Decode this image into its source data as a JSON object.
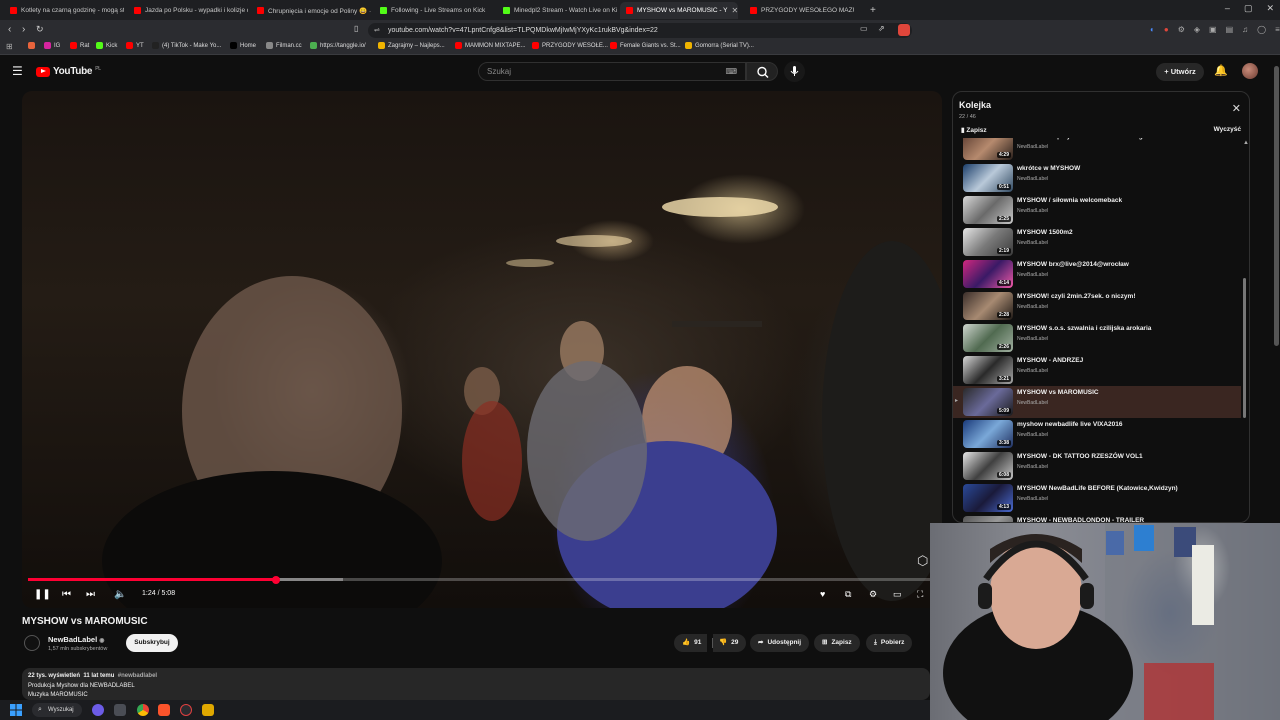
{
  "browser": {
    "tabs": [
      {
        "label": "Kotlety na czarną godzinę - mogą st",
        "color": "#ff0000"
      },
      {
        "label": "Jazda po Polsku - wypadki i kolizje d",
        "color": "#ff0000"
      },
      {
        "label": "Chrupnięcia i emocje od Poliny 😀 ·",
        "color": "#ff0000"
      },
      {
        "label": "Following - Live Streams on Kick",
        "color": "#53fc18"
      },
      {
        "label": "Minedpl2 Stream - Watch Live on Ki",
        "color": "#53fc18"
      },
      {
        "label": "MYSHOW vs MAROMUSIC - Y",
        "color": "#ff0000"
      },
      {
        "label": "PRZYGODY WESOŁEGO MAZURA wr",
        "color": "#ff0000"
      }
    ],
    "new_tab": "+",
    "window_controls": [
      "–",
      "▢",
      "✕"
    ],
    "url": "youtube.com/watch?v=47LpntCnfg8&list=TLPQMDkwMjIwMjYXyKc1rukBVg&index=22",
    "bookmarks": [
      {
        "label": "",
        "color": "#e8643c"
      },
      {
        "label": "IG",
        "color": "#d6249f"
      },
      {
        "label": "Rat",
        "color": "#ff0000"
      },
      {
        "label": "Kick",
        "color": "#53fc18"
      },
      {
        "label": "YT",
        "color": "#ff0000"
      },
      {
        "label": "(4) TikTok - Make Yo...",
        "color": "#222222"
      },
      {
        "label": "Home",
        "color": "#000000"
      },
      {
        "label": "Filman.cc",
        "color": "#888888"
      },
      {
        "label": "https://tanggle.io/",
        "color": "#4caf50"
      },
      {
        "label": "Zagrajmy – Najleps...",
        "color": "#f0b400"
      },
      {
        "label": "MAMMON MIXTAPE...",
        "color": "#ff0000"
      },
      {
        "label": "PRZYGODY WESOŁE...",
        "color": "#ff0000"
      },
      {
        "label": "Female Giants vs. St...",
        "color": "#ff0000"
      },
      {
        "label": "Gomorra (Serial TV)...",
        "color": "#f0b400"
      }
    ]
  },
  "youtube": {
    "logo_text": "YouTube",
    "logo_region": "PL",
    "search_placeholder": "Szukaj",
    "create_label": "Utwórz",
    "accent_color": "#ff0033"
  },
  "player": {
    "current_time": "1:24",
    "duration": "5:08",
    "time_display": "1:24 / 5:08",
    "played_fraction": 0.273,
    "buffered_fraction": 0.347
  },
  "video": {
    "title": "MYSHOW vs MAROMUSIC",
    "channel": "NewBadLabel",
    "verified_mark": "◉",
    "subscribers": "1,57 mln subskrybentów",
    "subscribe_label": "Subskrybuj",
    "likes": "91",
    "dislikes": "29",
    "share_label": "Udostępnij",
    "save_label": "Zapisz",
    "download_label": "Pobierz",
    "views": "22 tys. wyświetleń",
    "age": "11 lat temu",
    "hashtag": "#newbadlabel",
    "desc_line1": "Produkcja Myshow dla NEWBADLABEL",
    "desc_line2": "Muzyka MAROMUSIC"
  },
  "queue": {
    "title": "Kolejka",
    "position": "22 / 46",
    "save_label": "Zapisz",
    "clear_label": "Wyczyść",
    "items": [
      {
        "title": "MYSHOW X! przykazanie video backstage",
        "channel": "NewBadLabel",
        "duration": "4:29",
        "active": false
      },
      {
        "title": "wkrótce w MYSHOW",
        "channel": "NewBadLabel",
        "duration": "0:51",
        "active": false
      },
      {
        "title": "MYSHOW / siłownia welcomeback",
        "channel": "NewBadLabel",
        "duration": "2:25",
        "active": false
      },
      {
        "title": "MYSHOW 1500m2",
        "channel": "NewBadLabel",
        "duration": "2:19",
        "active": false
      },
      {
        "title": "MYSHOW brx@live@2014@wrocław",
        "channel": "NewBadLabel",
        "duration": "4:14",
        "active": false
      },
      {
        "title": "MYSHOW! czyli 2min.27sek. o niczym!",
        "channel": "NewBadLabel",
        "duration": "2:28",
        "active": false
      },
      {
        "title": "MYSHOW s.o.s. szwalnia i czilijska arokaria",
        "channel": "NewBadLabel",
        "duration": "2:26",
        "active": false
      },
      {
        "title": "MYSHOW - ANDRZEJ",
        "channel": "NewBadLabel",
        "duration": "3:21",
        "active": false
      },
      {
        "title": "MYSHOW vs MAROMUSIC",
        "channel": "NewBadLabel",
        "duration": "5:09",
        "active": true
      },
      {
        "title": "myshow newbadlife live VIXA2016",
        "channel": "NewBadLabel",
        "duration": "3:38",
        "active": false
      },
      {
        "title": "MYSHOW - DK TATTOO RZESZÓW VOL1",
        "channel": "NewBadLabel",
        "duration": "6:08",
        "active": false
      },
      {
        "title": "MYSHOW NewBadLife BEFORE (Katowice,Kwidzyn)",
        "channel": "NewBadLabel",
        "duration": "4:13",
        "active": false
      },
      {
        "title": "MYSHOW - NEWBADLONDON - TRAILER",
        "channel": "NewBadLabel",
        "duration": "",
        "active": false
      }
    ]
  },
  "taskbar": {
    "search_label": "Wyszukaj"
  }
}
